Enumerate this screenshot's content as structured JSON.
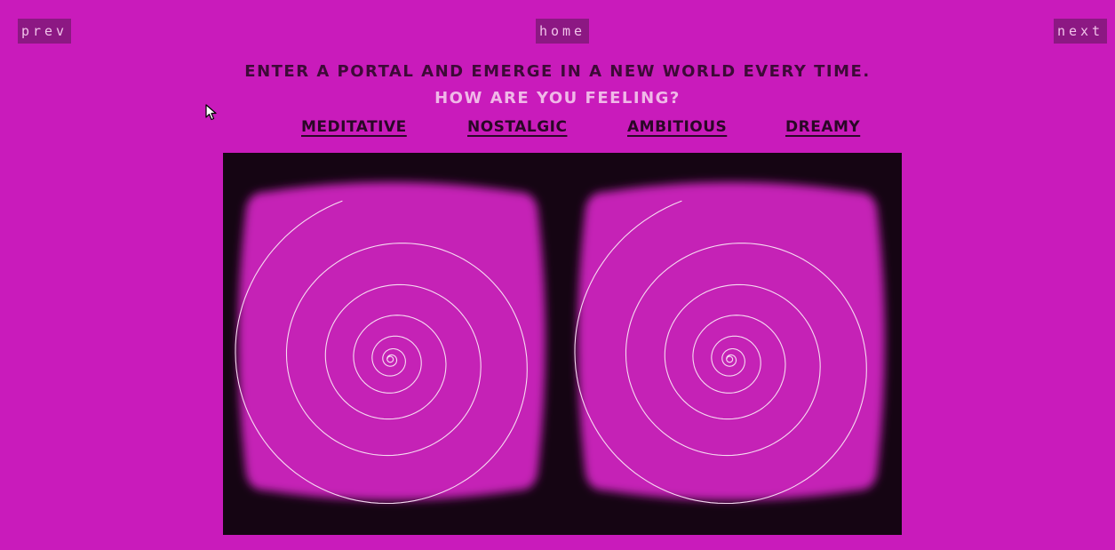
{
  "nav": {
    "prev_label": "prev",
    "home_label": "home",
    "next_label": "next"
  },
  "headline": "Enter a portal and emerge in a new world every time.",
  "subheadline": "How are you feeling?",
  "moods": [
    {
      "label": "Meditative"
    },
    {
      "label": "Nostalgic"
    },
    {
      "label": "Ambitious"
    },
    {
      "label": "Dreamy"
    }
  ],
  "colors": {
    "background": "#c91bbb",
    "nav_button": "#8c1883",
    "viewer_background": "#150513",
    "lens": "#c523b6"
  },
  "viewer": {
    "mode": "stereo-vr",
    "content": "spiral-tunnel"
  }
}
